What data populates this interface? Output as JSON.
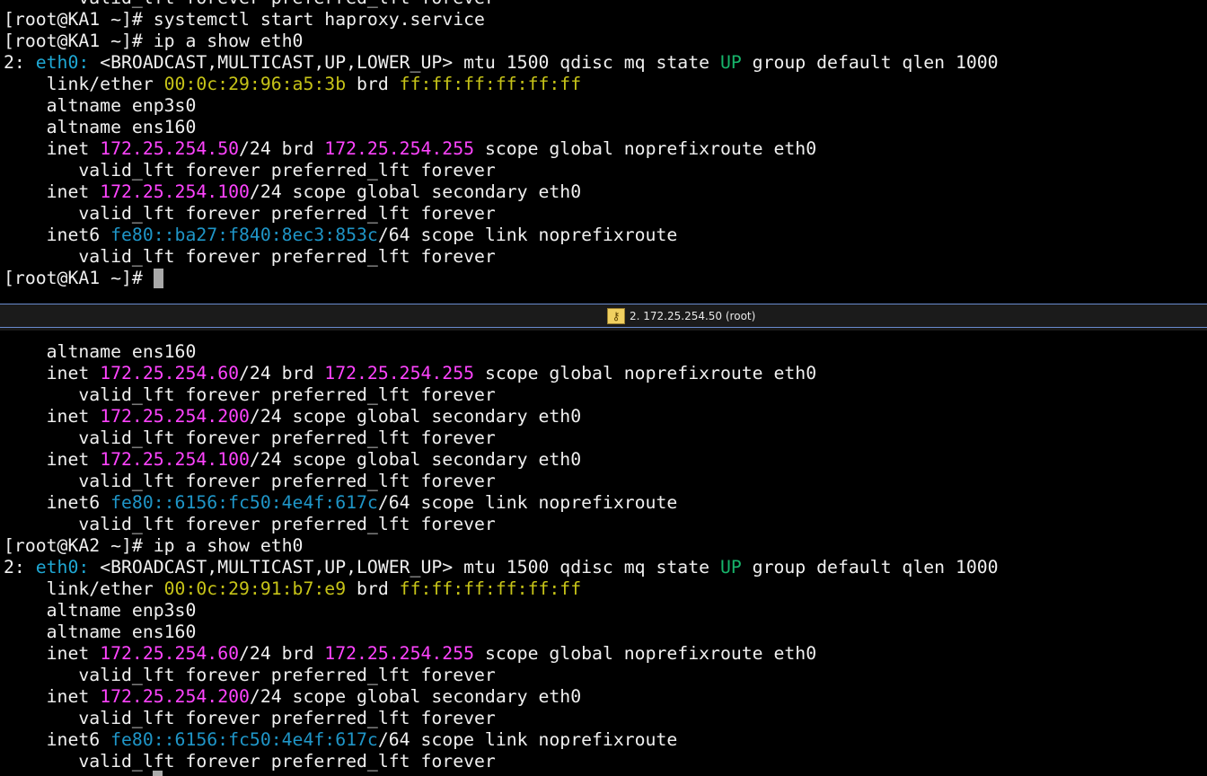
{
  "colors": {
    "default": "#f0f0f0",
    "ip_magenta": "#ff44ff",
    "iface_cyan": "#1fa8d4",
    "state_green": "#17b56b",
    "mac_yellow": "#c7c418",
    "ipv6_blue": "#1f96c8"
  },
  "divider": {
    "tab_title": "2. 172.25.254.50 (root)",
    "icon": "key-icon"
  },
  "top_pane": {
    "lines": [
      [
        {
          "t": "       valid_lft forever preferred_lft forever",
          "c": "default"
        }
      ],
      [
        {
          "t": "[root@KA1 ~]# systemctl start haproxy.service",
          "c": "default"
        }
      ],
      [
        {
          "t": "[root@KA1 ~]# ip a show eth0",
          "c": "default"
        }
      ],
      [
        {
          "t": "2: ",
          "c": "default"
        },
        {
          "t": "eth0:",
          "c": "iface_cyan"
        },
        {
          "t": " <BROADCAST,MULTICAST,UP,LOWER_UP> mtu 1500 qdisc mq state ",
          "c": "default"
        },
        {
          "t": "UP",
          "c": "state_green"
        },
        {
          "t": " group default qlen 1000",
          "c": "default"
        }
      ],
      [
        {
          "t": "    link/ether ",
          "c": "default"
        },
        {
          "t": "00:0c:29:96:a5:3b",
          "c": "mac_yellow"
        },
        {
          "t": " brd ",
          "c": "default"
        },
        {
          "t": "ff:ff:ff:ff:ff:ff",
          "c": "mac_yellow"
        }
      ],
      [
        {
          "t": "    altname enp3s0",
          "c": "default"
        }
      ],
      [
        {
          "t": "    altname ens160",
          "c": "default"
        }
      ],
      [
        {
          "t": "    inet ",
          "c": "default"
        },
        {
          "t": "172.25.254.50",
          "c": "ip_magenta"
        },
        {
          "t": "/24 brd ",
          "c": "default"
        },
        {
          "t": "172.25.254.255",
          "c": "ip_magenta"
        },
        {
          "t": " scope global noprefixroute eth0",
          "c": "default"
        }
      ],
      [
        {
          "t": "       valid_lft forever preferred_lft forever",
          "c": "default"
        }
      ],
      [
        {
          "t": "    inet ",
          "c": "default"
        },
        {
          "t": "172.25.254.100",
          "c": "ip_magenta"
        },
        {
          "t": "/24 scope global secondary eth0",
          "c": "default"
        }
      ],
      [
        {
          "t": "       valid_lft forever preferred_lft forever",
          "c": "default"
        }
      ],
      [
        {
          "t": "    inet6 ",
          "c": "default"
        },
        {
          "t": "fe80::ba27:f840:8ec3:853c",
          "c": "ipv6_blue"
        },
        {
          "t": "/64 scope link noprefixroute",
          "c": "default"
        }
      ],
      [
        {
          "t": "       valid_lft forever preferred_lft forever",
          "c": "default"
        }
      ],
      [
        {
          "t": "[root@KA1 ~]# ",
          "c": "default"
        }
      ]
    ]
  },
  "bottom_pane": {
    "lines": [
      [
        {
          "t": "    altname ens160",
          "c": "default"
        }
      ],
      [
        {
          "t": "    inet ",
          "c": "default"
        },
        {
          "t": "172.25.254.60",
          "c": "ip_magenta"
        },
        {
          "t": "/24 brd ",
          "c": "default"
        },
        {
          "t": "172.25.254.255",
          "c": "ip_magenta"
        },
        {
          "t": " scope global noprefixroute eth0",
          "c": "default"
        }
      ],
      [
        {
          "t": "       valid_lft forever preferred_lft forever",
          "c": "default"
        }
      ],
      [
        {
          "t": "    inet ",
          "c": "default"
        },
        {
          "t": "172.25.254.200",
          "c": "ip_magenta"
        },
        {
          "t": "/24 scope global secondary eth0",
          "c": "default"
        }
      ],
      [
        {
          "t": "       valid_lft forever preferred_lft forever",
          "c": "default"
        }
      ],
      [
        {
          "t": "    inet ",
          "c": "default"
        },
        {
          "t": "172.25.254.100",
          "c": "ip_magenta"
        },
        {
          "t": "/24 scope global secondary eth0",
          "c": "default"
        }
      ],
      [
        {
          "t": "       valid_lft forever preferred_lft forever",
          "c": "default"
        }
      ],
      [
        {
          "t": "    inet6 ",
          "c": "default"
        },
        {
          "t": "fe80::6156:fc50:4e4f:617c",
          "c": "ipv6_blue"
        },
        {
          "t": "/64 scope link noprefixroute",
          "c": "default"
        }
      ],
      [
        {
          "t": "       valid_lft forever preferred_lft forever",
          "c": "default"
        }
      ],
      [
        {
          "t": "[root@KA2 ~]# ip a show eth0",
          "c": "default"
        }
      ],
      [
        {
          "t": "2: ",
          "c": "default"
        },
        {
          "t": "eth0:",
          "c": "iface_cyan"
        },
        {
          "t": " <BROADCAST,MULTICAST,UP,LOWER_UP> mtu 1500 qdisc mq state ",
          "c": "default"
        },
        {
          "t": "UP",
          "c": "state_green"
        },
        {
          "t": " group default qlen 1000",
          "c": "default"
        }
      ],
      [
        {
          "t": "    link/ether ",
          "c": "default"
        },
        {
          "t": "00:0c:29:91:b7:e9",
          "c": "mac_yellow"
        },
        {
          "t": " brd ",
          "c": "default"
        },
        {
          "t": "ff:ff:ff:ff:ff:ff",
          "c": "mac_yellow"
        }
      ],
      [
        {
          "t": "    altname enp3s0",
          "c": "default"
        }
      ],
      [
        {
          "t": "    altname ens160",
          "c": "default"
        }
      ],
      [
        {
          "t": "    inet ",
          "c": "default"
        },
        {
          "t": "172.25.254.60",
          "c": "ip_magenta"
        },
        {
          "t": "/24 brd ",
          "c": "default"
        },
        {
          "t": "172.25.254.255",
          "c": "ip_magenta"
        },
        {
          "t": " scope global noprefixroute eth0",
          "c": "default"
        }
      ],
      [
        {
          "t": "       valid_lft forever preferred_lft forever",
          "c": "default"
        }
      ],
      [
        {
          "t": "    inet ",
          "c": "default"
        },
        {
          "t": "172.25.254.200",
          "c": "ip_magenta"
        },
        {
          "t": "/24 scope global secondary eth0",
          "c": "default"
        }
      ],
      [
        {
          "t": "       valid_lft forever preferred_lft forever",
          "c": "default"
        }
      ],
      [
        {
          "t": "    inet6 ",
          "c": "default"
        },
        {
          "t": "fe80::6156:fc50:4e4f:617c",
          "c": "ipv6_blue"
        },
        {
          "t": "/64 scope link noprefixroute",
          "c": "default"
        }
      ],
      [
        {
          "t": "       valid_lft forever preferred_lft forever",
          "c": "default"
        }
      ]
    ]
  }
}
